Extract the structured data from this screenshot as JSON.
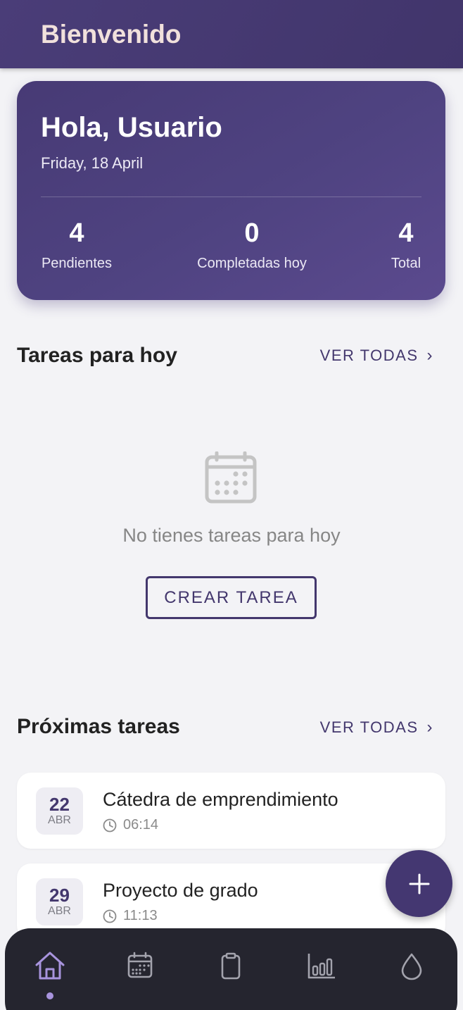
{
  "app_bar": {
    "title": "Bienvenido"
  },
  "summary": {
    "greeting": "Hola, Usuario",
    "date": "Friday, 18 April",
    "stats": [
      {
        "value": "4",
        "label": "Pendientes"
      },
      {
        "value": "0",
        "label": "Completadas hoy"
      },
      {
        "value": "4",
        "label": "Total"
      }
    ]
  },
  "today_section": {
    "title": "Tareas para hoy",
    "see_all": "VER TODAS",
    "empty_icon": "calendar-icon",
    "empty_message": "No tienes tareas para hoy",
    "create_button": "CREAR TAREA"
  },
  "upcoming_section": {
    "title": "Próximas tareas",
    "see_all": "VER TODAS",
    "tasks": [
      {
        "day": "22",
        "month": "ABR",
        "title": "Cátedra de emprendimiento",
        "time": "06:14"
      },
      {
        "day": "29",
        "month": "ABR",
        "title": "Proyecto de grado",
        "time": "11:13"
      }
    ]
  },
  "fab": {
    "icon": "plus-icon"
  },
  "bottom_nav": {
    "items": [
      {
        "icon": "home-icon",
        "active": true
      },
      {
        "icon": "calendar-icon",
        "active": false
      },
      {
        "icon": "clipboard-icon",
        "active": false
      },
      {
        "icon": "bar-chart-icon",
        "active": false
      },
      {
        "icon": "drop-icon",
        "active": false
      }
    ]
  },
  "colors": {
    "primary": "#43376d",
    "background": "#f3f3f6",
    "nav_background": "#25252f",
    "nav_active": "#a894dd",
    "nav_inactive": "#a3a3ad",
    "app_bar_text": "#f1e1dc"
  }
}
